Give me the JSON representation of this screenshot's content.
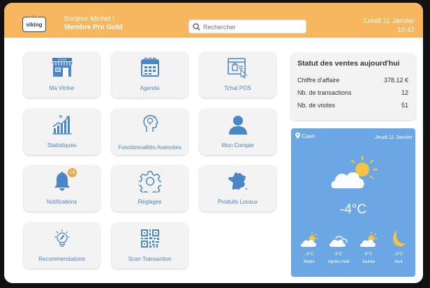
{
  "header": {
    "logo_text": "viking",
    "greeting": "Bonjour Michel !",
    "membership": "Membre Pro Gold",
    "search_placeholder": "Rechercher",
    "date": "Lundi 11 Janvier",
    "time": "10:47"
  },
  "tiles": [
    {
      "label": "Ma Vitrine",
      "icon": "store-icon"
    },
    {
      "label": "Agenda",
      "icon": "calendar-icon"
    },
    {
      "label": "Tchat POS",
      "icon": "chat-window-icon"
    },
    {
      "label": "Statistiques",
      "icon": "growth-chart-icon"
    },
    {
      "label": "Fonctionnalités Avancées",
      "icon": "idea-head-icon"
    },
    {
      "label": "Mon Compte",
      "icon": "user-icon"
    },
    {
      "label": "Notifications",
      "icon": "bell-icon",
      "badge": "18"
    },
    {
      "label": "Réglages",
      "icon": "gear-icon"
    },
    {
      "label": "Produits Locaux",
      "icon": "france-map-icon"
    },
    {
      "label": "Recommendations",
      "icon": "lightbulb-icon"
    },
    {
      "label": "Scan Transaction",
      "icon": "qr-code-icon"
    }
  ],
  "sales": {
    "title": "Statut des ventes aujourd'hui",
    "rows": [
      {
        "label": "Chiffre d'affaire",
        "value": "378.12 €"
      },
      {
        "label": "Nb. de transactions",
        "value": "12"
      },
      {
        "label": "Nb. de visites",
        "value": "51"
      }
    ]
  },
  "weather": {
    "city": "Caen",
    "date": "Jeudi 11 Janvier",
    "current_temp": "-4°C",
    "forecast": [
      {
        "temp": "-4°C",
        "period": "Matin",
        "icon": "sun-cloud-icon"
      },
      {
        "temp": "3°C",
        "period": "Après-midi",
        "icon": "cloud-icon"
      },
      {
        "temp": "0°C",
        "period": "Soirée",
        "icon": "sun-cloud-icon"
      },
      {
        "temp": "-3°C",
        "period": "Nuit",
        "icon": "moon-icon"
      }
    ]
  },
  "colors": {
    "header": "#f7b75e",
    "accent_blue": "#4a86c8",
    "weather_bg": "#6aa7e4",
    "sun": "#f7c340",
    "badge": "#f0a64a"
  }
}
